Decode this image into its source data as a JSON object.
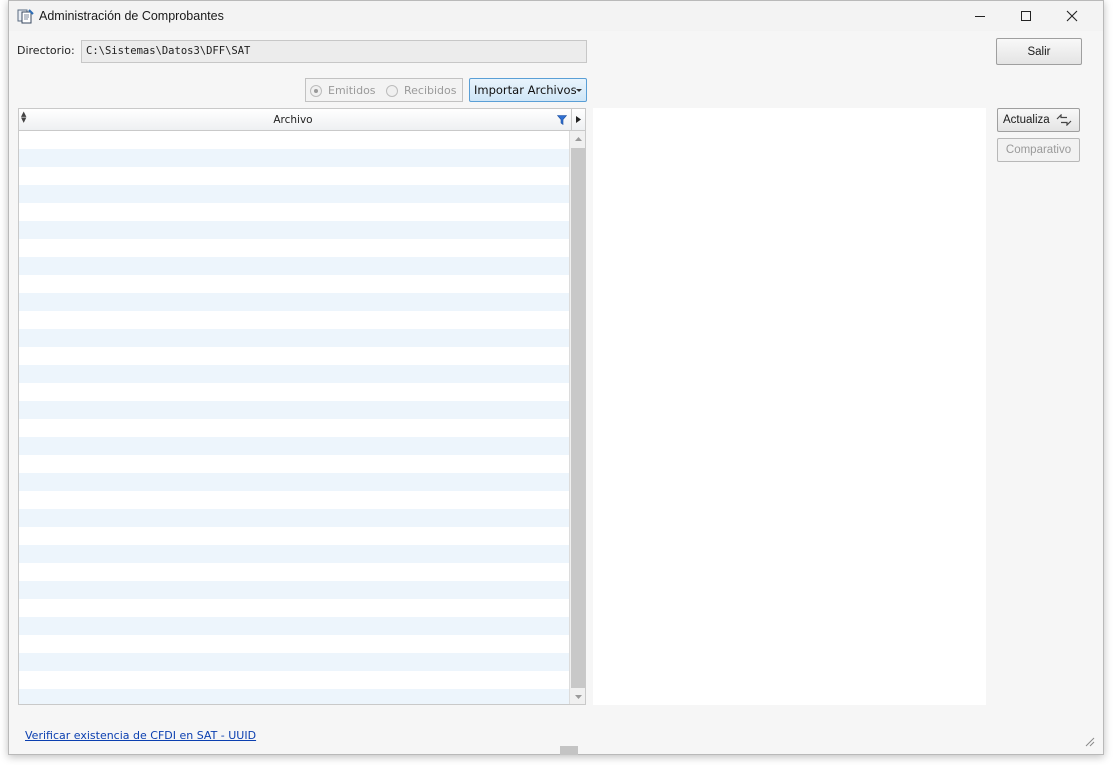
{
  "window": {
    "title": "Administración de Comprobantes"
  },
  "directory": {
    "label": "Directorio:",
    "value": "C:\\Sistemas\\Datos3\\DFF\\SAT"
  },
  "buttons": {
    "exit": "Salir",
    "refresh": "Actualiza",
    "compare": "Comparativo",
    "import": "Importar Archivos"
  },
  "filter": {
    "options": [
      {
        "label": "Emitidos",
        "selected": true,
        "enabled": false
      },
      {
        "label": "Recibidos",
        "selected": false,
        "enabled": false
      }
    ]
  },
  "grid": {
    "columns": [
      "Archivo"
    ]
  },
  "footer": {
    "link": "Verificar existencia de CFDI en SAT - UUID"
  },
  "colors": {
    "row_alt": "#edf5fc",
    "import_bg": "#d8ecfa",
    "link": "#0b3fb0"
  },
  "icons": {
    "app": "app-documents-icon",
    "filter": "funnel-icon",
    "refresh": "refresh-arrows-icon"
  }
}
